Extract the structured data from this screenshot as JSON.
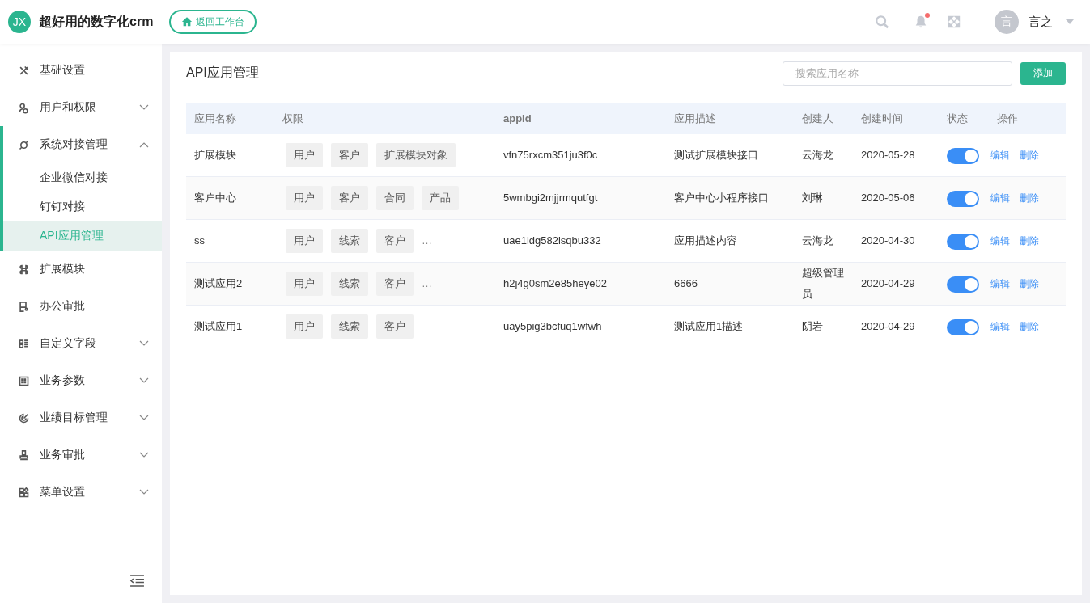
{
  "header": {
    "logo": "JX",
    "app_name": "超好用的数字化crm",
    "back_button": "返回工作台",
    "notification_dot": true,
    "avatar": "言",
    "user_name": "言之"
  },
  "sidebar": {
    "items": [
      {
        "label": "基础设置"
      },
      {
        "label": "用户和权限",
        "expanded": false
      },
      {
        "label": "系统对接管理",
        "expanded": true,
        "children": [
          {
            "label": "企业微信对接",
            "selected": false
          },
          {
            "label": "钉钉对接",
            "selected": false
          },
          {
            "label": "API应用管理",
            "selected": true
          }
        ]
      },
      {
        "label": "扩展模块"
      },
      {
        "label": "办公审批"
      },
      {
        "label": "自定义字段",
        "expanded": false
      },
      {
        "label": "业务参数",
        "expanded": false
      },
      {
        "label": "业绩目标管理",
        "expanded": false
      },
      {
        "label": "业务审批",
        "expanded": false
      },
      {
        "label": "菜单设置",
        "expanded": false
      }
    ]
  },
  "page": {
    "title": "API应用管理",
    "search": {
      "placeholder": "搜索应用名称"
    },
    "add_button": "添加"
  },
  "table": {
    "columns": [
      "应用名称",
      "权限",
      "appId",
      "应用描述",
      "创建人",
      "创建时间",
      "状态",
      "操作"
    ],
    "rows": [
      {
        "name": "扩展模块",
        "permissions": [
          "用户",
          "客户",
          "扩展模块对象"
        ],
        "appid": "vfn75rxcm351ju3f0c",
        "description": "测试扩展模块接口",
        "creator": "云海龙",
        "created": "2020-05-28",
        "on": true,
        "actions": [
          "编辑",
          "删除"
        ]
      },
      {
        "name": "客户中心",
        "permissions": [
          "用户",
          "客户",
          "合同",
          "产品"
        ],
        "appid": "5wmbgi2mjjrmqutfgt",
        "description": "客户中心小程序接口",
        "creator": "刘琳",
        "created": "2020-05-06",
        "on": true,
        "actions": [
          "编辑",
          "删除"
        ]
      },
      {
        "name": "ss",
        "permissions": [
          "用户",
          "线索",
          "客户"
        ],
        "more": "…",
        "appid": "uae1idg582lsqbu332",
        "description": "应用描述内容",
        "creator": "云海龙",
        "created": "2020-04-30",
        "on": true,
        "actions": [
          "编辑",
          "删除"
        ]
      },
      {
        "name": "测试应用2",
        "permissions": [
          "用户",
          "线索",
          "客户"
        ],
        "more": "…",
        "appid": "h2j4g0sm2e85heye02",
        "description": "6666",
        "creator": "超级管理员",
        "created": "2020-04-29",
        "on": true,
        "actions": [
          "编辑",
          "删除"
        ]
      },
      {
        "name": "测试应用1",
        "permissions": [
          "用户",
          "线索",
          "客户"
        ],
        "appid": "uay5pig3bcfuq1wfwh",
        "description": "测试应用1描述",
        "creator": "阴岩",
        "created": "2020-04-29",
        "on": true,
        "actions": [
          "编辑",
          "删除"
        ]
      }
    ]
  }
}
